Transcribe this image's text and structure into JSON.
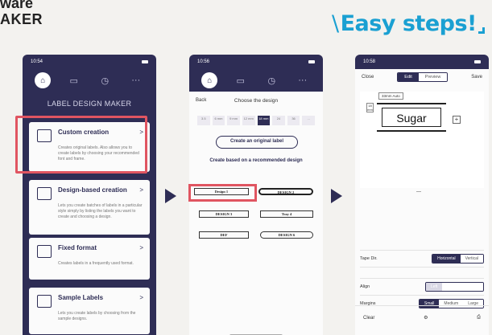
{
  "header": {
    "line1": "ware",
    "line2": "AKER",
    "easy_steps": "Easy steps!",
    "easy_prefix": "\\"
  },
  "colors": {
    "accent": "#1aa0d2",
    "phone_bg": "#2e2d55",
    "highlight": "#e05561"
  },
  "screen1": {
    "time": "10:54",
    "app_title": "LABEL DESIGN MAKER",
    "nav_icons": [
      "home-icon",
      "folder-icon",
      "clock-icon",
      "more-icon"
    ],
    "cards": [
      {
        "icon": "label-icon",
        "title": "Custom creation",
        "desc": "Creates original labels. Also allows you to create labels by choosing your recommended font and frame."
      },
      {
        "icon": "list-icon",
        "title": "Design-based creation",
        "desc": "Lets you create batches of labels in a particular style simply by listing the labels you want to create and choosing a design."
      },
      {
        "icon": "grid-icon",
        "title": "Fixed format",
        "desc": "Creates labels in a frequently used format."
      },
      {
        "icon": "sample-icon",
        "title": "Sample Labels",
        "desc": "Lets you create labels by choosing from the sample designs."
      }
    ]
  },
  "screen2": {
    "time": "10:56",
    "back_label": "Back",
    "title": "Choose the design",
    "tapes": [
      "3.5",
      "6 mm",
      "9 mm",
      "12 mm",
      "18 mm",
      "24",
      "36",
      "..."
    ],
    "original_button": "Create an original label",
    "based_title": "Create based on a recommended design",
    "designs": [
      "Design 1",
      "DESIGN 2",
      "DESIGN 3",
      "Tray 4",
      "DEF",
      "DESIGN 6"
    ]
  },
  "screen3": {
    "time": "10:58",
    "close_label": "Close",
    "edit_label": "Edit",
    "preview_label": "Preview",
    "save_label": "Save",
    "auto_tag": "33mm Auto",
    "len_value": "18 mm",
    "label_text": "Sugar",
    "tape_dir_label": "Tape Dir.",
    "tape_dir_options": [
      "Horizontal",
      "Vertical"
    ],
    "align_label": "Align",
    "align_options": [
      "Left",
      "Center",
      "Right"
    ],
    "margins_label": "Margins",
    "margin_options": [
      "Small",
      "Medium",
      "Large"
    ],
    "clear_label": "Clear"
  }
}
